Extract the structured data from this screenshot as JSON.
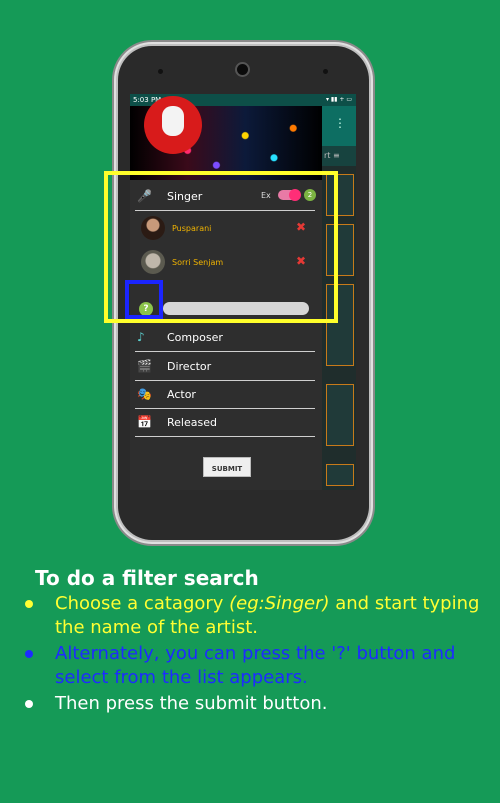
{
  "status": {
    "time": "5:03 PM",
    "icons": "▾ ▮▮ + ▭"
  },
  "appbar": {
    "kebab": "⋮",
    "sort_fragment": "rt ≡"
  },
  "drawer": {
    "category_selected": "Singer",
    "ex_label": "Ex",
    "selected_count": "2",
    "selected_artists": [
      {
        "name": "Pusparani"
      },
      {
        "name": "Sorri Senjam"
      }
    ],
    "help_label": "?",
    "search_value": "",
    "categories": [
      {
        "label": "Composer"
      },
      {
        "label": "Director"
      },
      {
        "label": "Actor"
      },
      {
        "label": "Released"
      }
    ],
    "submit_label": "SUBMIT"
  },
  "instructions": {
    "title": "To do a filter search",
    "bullet1_a": "Choose a catagory ",
    "bullet1_example": "(eg:Singer)",
    "bullet1_b": " and start typing the name of the artist.",
    "bullet2": "Alternately, you can press the '?' button and select from the list appears.",
    "bullet3": "Then press the submit button."
  },
  "colors": {
    "background": "#159a57",
    "highlight_yellow": "#ffff2b",
    "highlight_blue": "#1b25ff",
    "accent_teal": "#0d6e62",
    "remove_red": "#e53935"
  }
}
